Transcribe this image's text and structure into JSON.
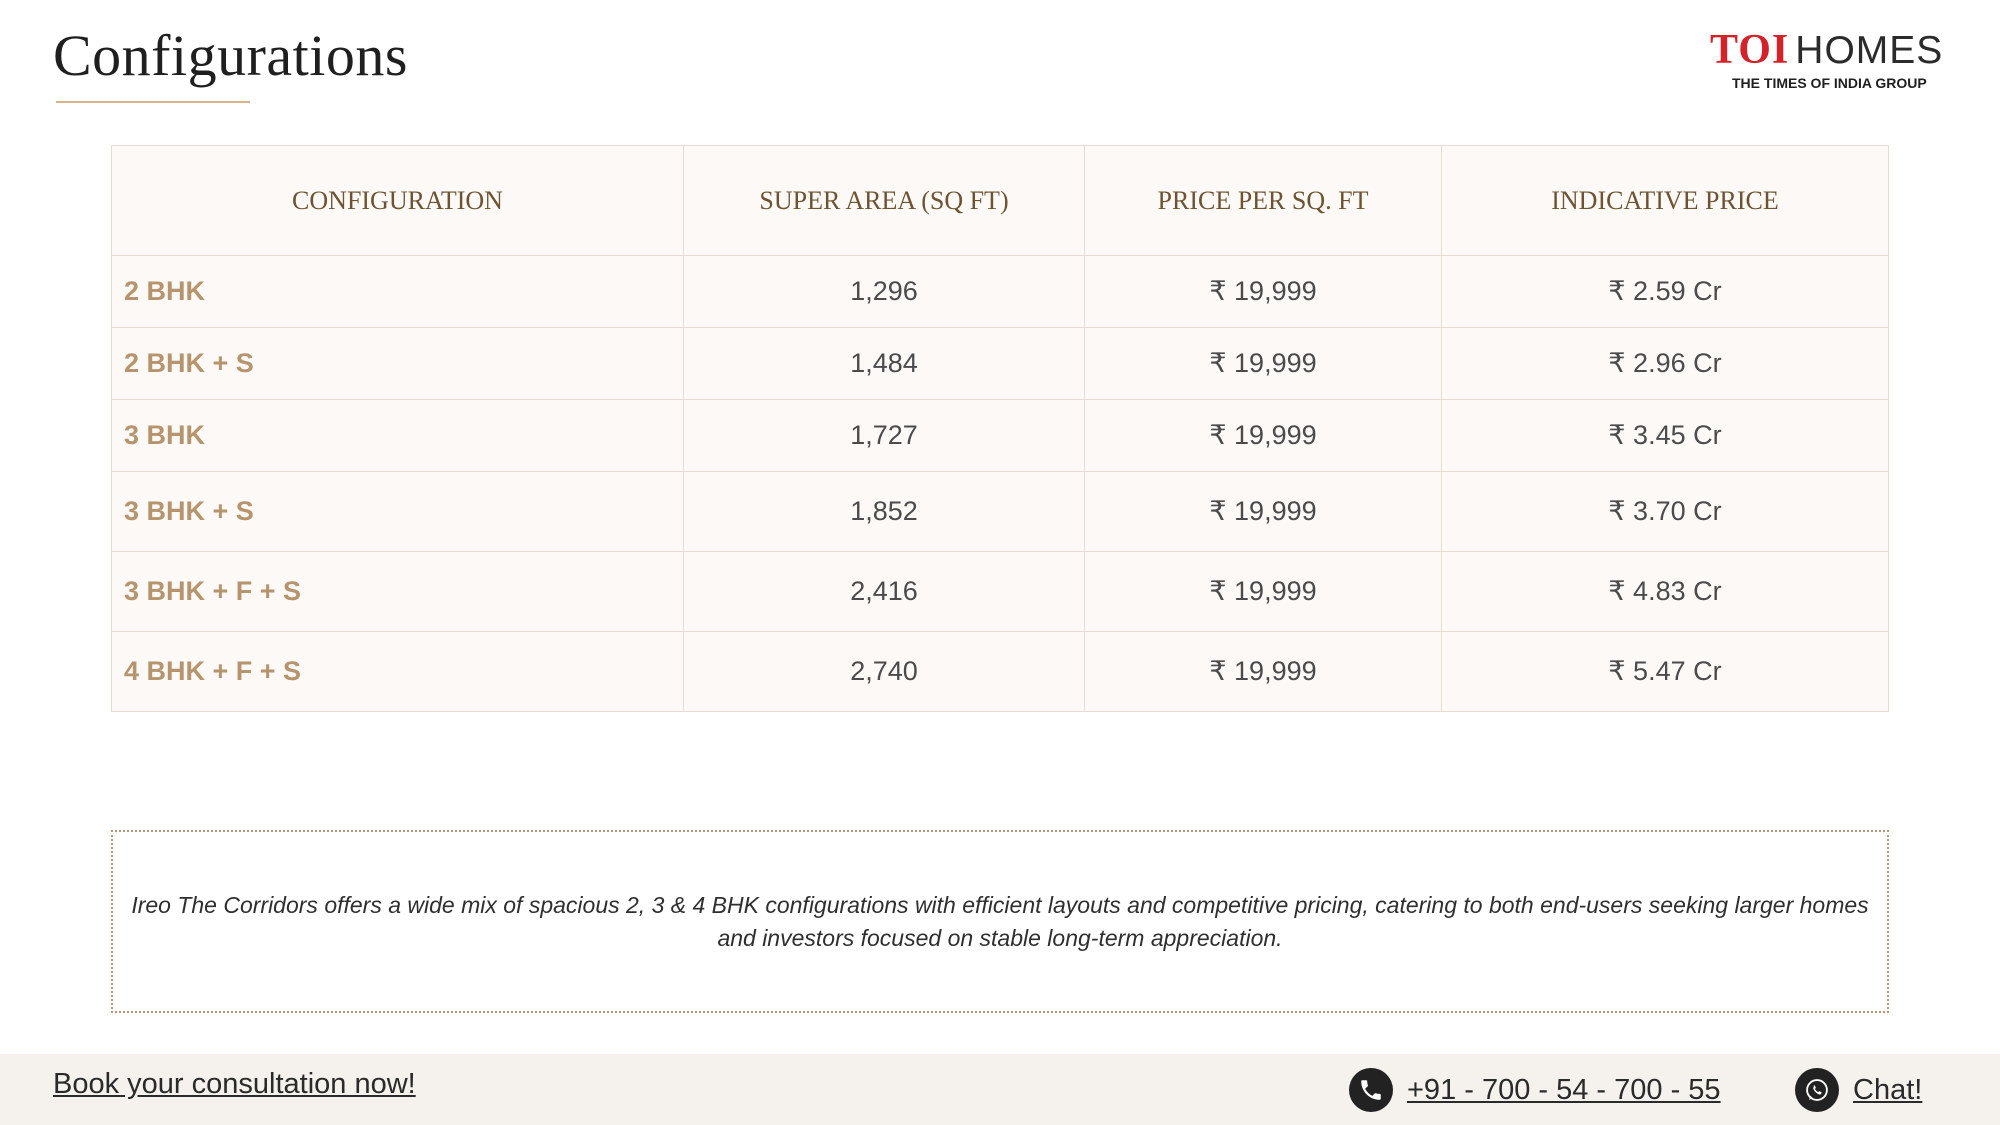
{
  "header": {
    "title": "Configurations",
    "logo": {
      "brand_main": "TOI",
      "brand_suffix": "HOMES",
      "tagline": "THE TIMES OF INDIA GROUP"
    }
  },
  "table": {
    "columns": [
      "CONFIGURATION",
      "SUPER AREA (SQ FT)",
      "PRICE PER SQ. FT",
      "INDICATIVE PRICE"
    ],
    "rows": [
      {
        "configuration": "2 BHK",
        "super_area": "1,296",
        "price_per_sqft": "₹ 19,999",
        "indicative_price": "₹ 2.59 Cr"
      },
      {
        "configuration": "2 BHK + S",
        "super_area": "1,484",
        "price_per_sqft": "₹ 19,999",
        "indicative_price": "₹ 2.96 Cr"
      },
      {
        "configuration": "3 BHK",
        "super_area": "1,727",
        "price_per_sqft": "₹ 19,999",
        "indicative_price": "₹ 3.45 Cr"
      },
      {
        "configuration": "3 BHK + S",
        "super_area": "1,852",
        "price_per_sqft": "₹ 19,999",
        "indicative_price": "₹ 3.70 Cr"
      },
      {
        "configuration": "3 BHK + F + S",
        "super_area": "2,416",
        "price_per_sqft": "₹ 19,999",
        "indicative_price": "₹ 4.83 Cr"
      },
      {
        "configuration": "4 BHK + F + S",
        "super_area": "2,740",
        "price_per_sqft": "₹ 19,999",
        "indicative_price": "₹ 5.47 Cr"
      }
    ]
  },
  "note": "Ireo The Corridors offers a wide mix of spacious 2, 3 & 4 BHK configurations with efficient layouts and competitive pricing, catering to both end-users seeking larger homes and investors focused on stable long-term appreciation.",
  "footer": {
    "book_label": "Book your consultation now!",
    "phone_label": "+91 - 700 - 54 - 700 - 55",
    "phone_icon": "phone-icon",
    "chat_label": "Chat!",
    "chat_icon": "whatsapp-icon"
  },
  "colors": {
    "accent": "#b5946e",
    "header_text": "#6d5331",
    "brand_red": "#d2232a",
    "footer_bg": "#f5f1ec"
  }
}
